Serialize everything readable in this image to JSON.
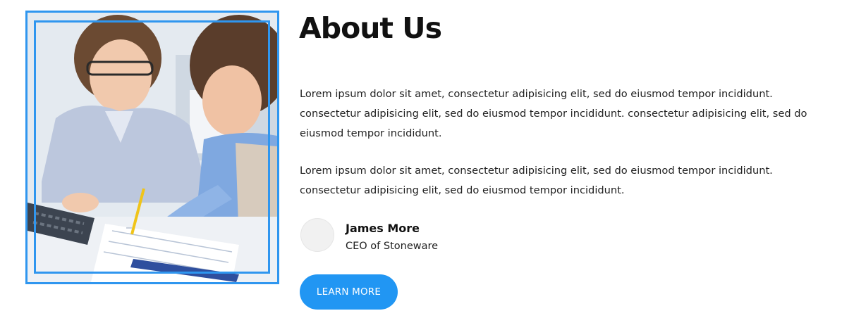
{
  "about": {
    "title": "About Us",
    "paragraphs": [
      "Lorem ipsum dolor sit amet, consectetur adipisicing elit, sed do eiusmod tempor incididunt. consectetur adipisicing elit, sed do eiusmod tempor incididunt. consectetur adipisicing elit, sed do eiusmod tempor incididunt.",
      "Lorem ipsum dolor sit amet, consectetur adipisicing elit, sed do eiusmod tempor incididunt. consectetur adipisicing elit, sed do eiusmod tempor incididunt."
    ]
  },
  "author": {
    "name": "James More",
    "role": "CEO of Stoneware"
  },
  "cta": {
    "label": "LEARN MORE"
  },
  "colors": {
    "accent": "#2196f3",
    "frame": "#2f96ef",
    "heading": "#111111",
    "text": "#222222"
  }
}
